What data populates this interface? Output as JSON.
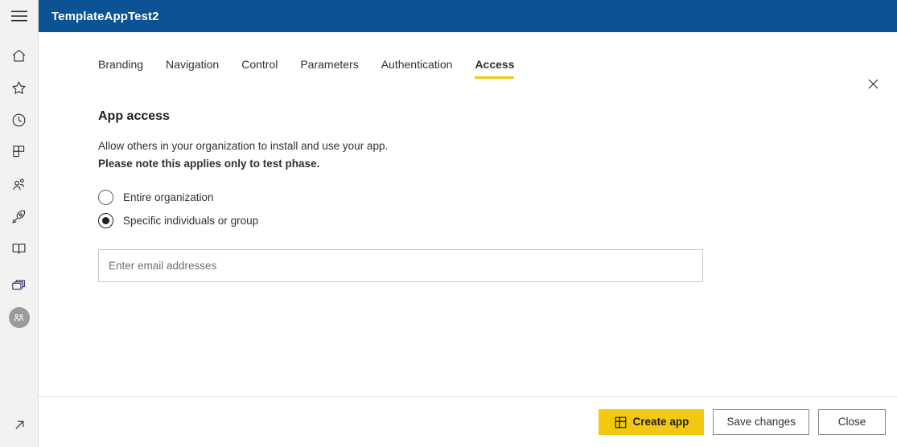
{
  "window": {
    "title": "TemplateAppTest2",
    "header_color": "#0b5394",
    "accent_color": "#f2c811"
  },
  "rail": {
    "menu_label": "Menu",
    "items": [
      {
        "name": "home",
        "label": "Home"
      },
      {
        "name": "favorites",
        "label": "Favorites"
      },
      {
        "name": "recent",
        "label": "Recent"
      },
      {
        "name": "apps",
        "label": "Apps"
      },
      {
        "name": "shared-with-me",
        "label": "Shared with me"
      },
      {
        "name": "deployment-pipelines",
        "label": "Deployment pipelines"
      },
      {
        "name": "learn",
        "label": "Learn"
      },
      {
        "name": "workspaces",
        "label": "Workspaces"
      }
    ],
    "workspace_avatar_label": "Workspace",
    "expand_label": "Expand"
  },
  "dialog": {
    "close_label": "Close dialog",
    "tabs": [
      {
        "label": "Branding",
        "active": false
      },
      {
        "label": "Navigation",
        "active": false
      },
      {
        "label": "Control",
        "active": false
      },
      {
        "label": "Parameters",
        "active": false
      },
      {
        "label": "Authentication",
        "active": false
      },
      {
        "label": "Access",
        "active": true
      }
    ],
    "section_title": "App access",
    "description_line1": "Allow others in your organization to install and use your app.",
    "description_line2": "Please note this applies only to test phase.",
    "radio_options": [
      {
        "label": "Entire organization",
        "selected": false
      },
      {
        "label": "Specific individuals or group",
        "selected": true
      }
    ],
    "email_input": {
      "value": "",
      "placeholder": "Enter email addresses"
    },
    "footer_buttons": {
      "create_app": "Create app",
      "save_changes": "Save changes",
      "close": "Close"
    }
  }
}
